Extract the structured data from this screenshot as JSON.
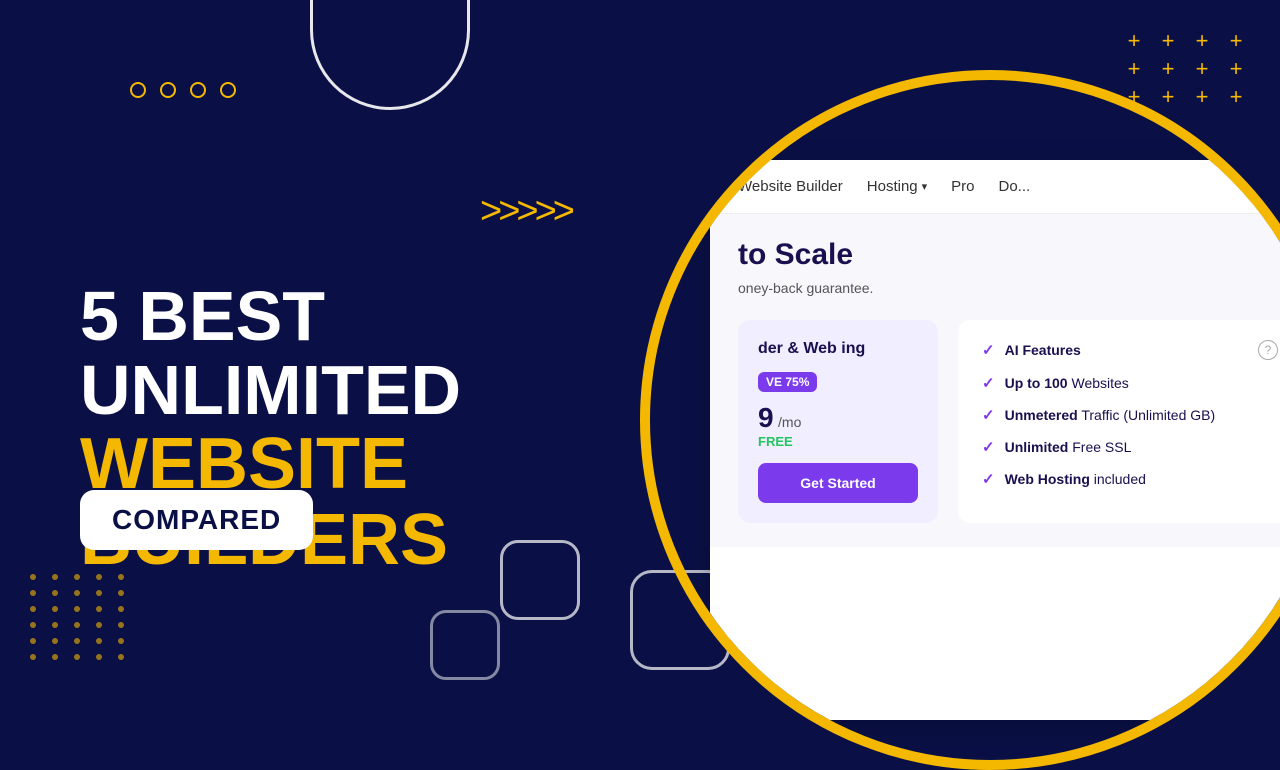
{
  "background": {
    "color": "#0a1045"
  },
  "decorative": {
    "circles_count": 4,
    "plus_symbol": "+",
    "chevrons": "»»»»»"
  },
  "main_title": {
    "line1": "5 BEST UNLIMITED",
    "line2": "WEBSITE BUILDERS"
  },
  "badge": {
    "label": "COMPARED"
  },
  "nav": {
    "items": [
      {
        "label": "Website Builder"
      },
      {
        "label": "Hosting",
        "has_dropdown": true
      },
      {
        "label": "Pro"
      },
      {
        "label": "Do..."
      }
    ]
  },
  "browser": {
    "page_title": "to Scale",
    "subtitle": "oney-back guarantee.",
    "plan": {
      "title": "der & Web\ning",
      "save_badge": "VE 75%",
      "price": "9",
      "price_unit": "/mo",
      "free_text": "FREE"
    },
    "features": [
      {
        "label": "AI Features",
        "bold_part": "AI Features",
        "has_info": true
      },
      {
        "label": "Up to 100 Websites",
        "bold_part": "Up to 100"
      },
      {
        "label": "Unmetered Traffic (Unlimited GB)",
        "bold_part": "Unmetered"
      },
      {
        "label": "Unlimited Free SSL",
        "bold_part": "Unlimited"
      },
      {
        "label": "Web Hosting included",
        "bold_part": "Web Hosting"
      }
    ]
  }
}
